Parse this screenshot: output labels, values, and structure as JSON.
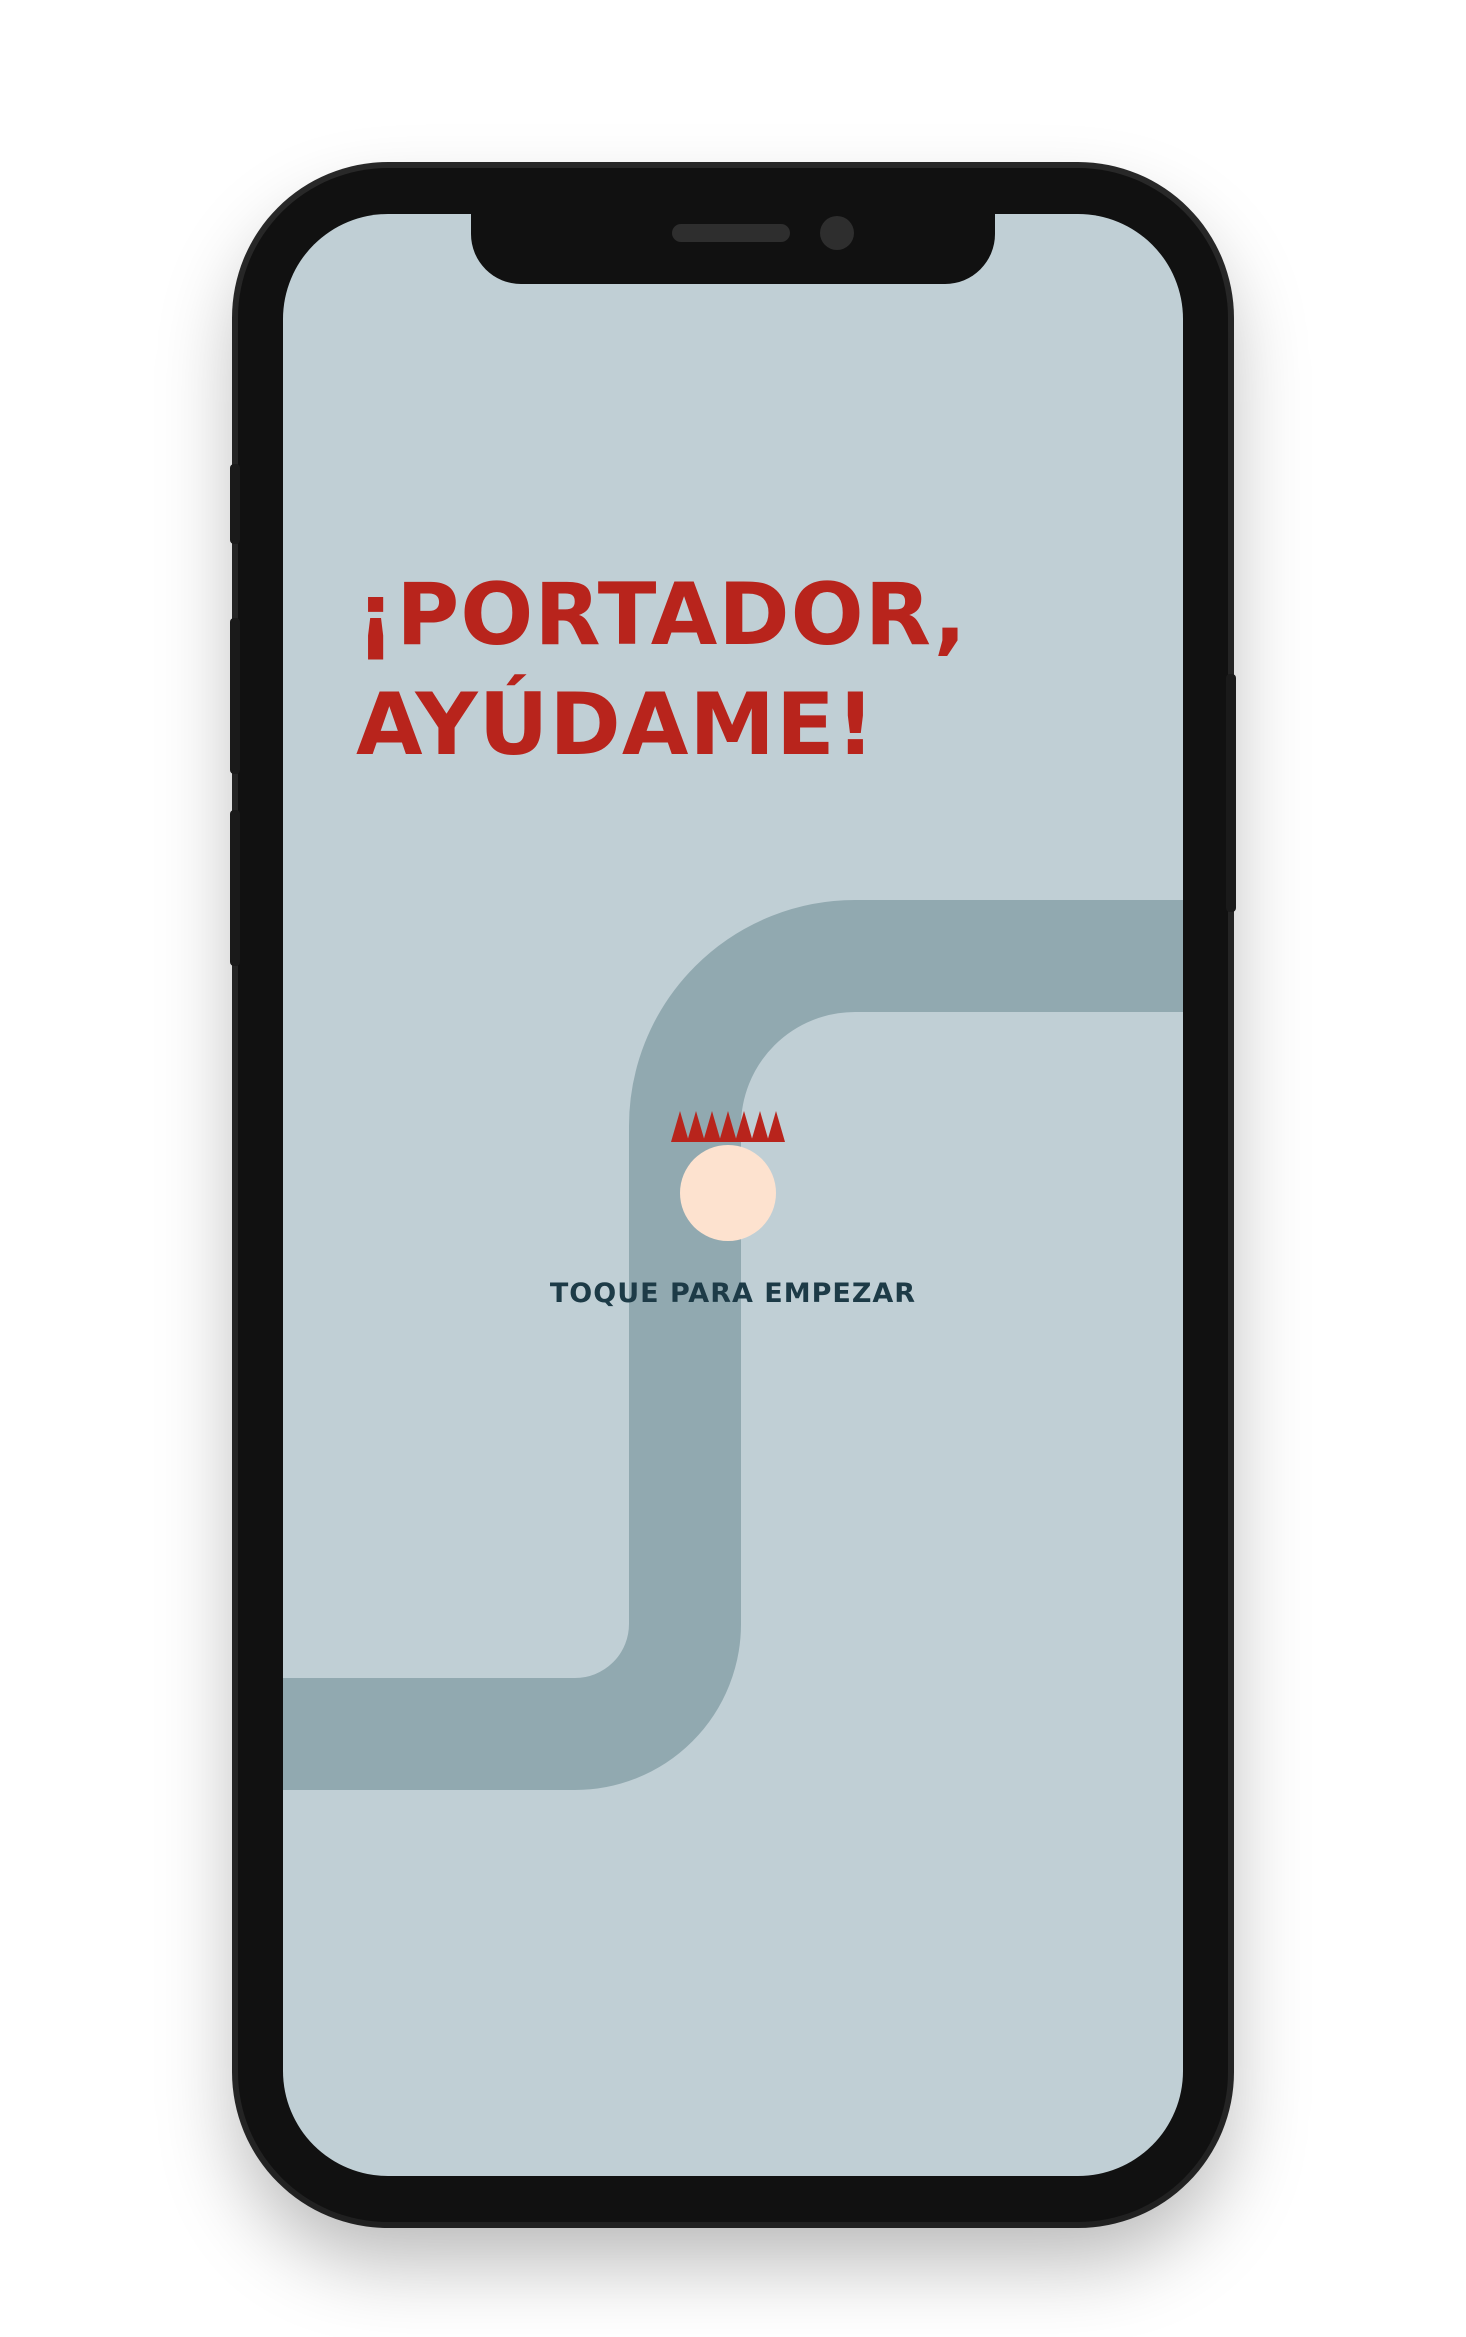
{
  "game": {
    "title_line1": "¡PORTADOR,",
    "title_line2": "AYÚDAME!",
    "start_prompt": "TOQUE PARA EMPEZAR"
  },
  "colors": {
    "background": "#c0cfd5",
    "pipe": "#91a9b0",
    "title": "#b8241c",
    "spikes": "#b8241c",
    "ball": "#fde2cf",
    "prompt_text": "#1d3b47"
  },
  "icons": {
    "spikes": "spikes-icon",
    "ball": "ball-icon"
  }
}
